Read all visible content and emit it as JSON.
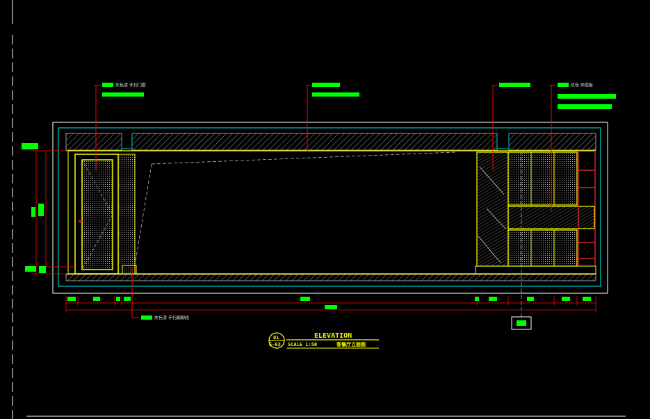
{
  "drawing": {
    "title": "ELEVATION",
    "scale": "SCALE 1:50",
    "subtitle": "客餐厅立面图",
    "bubble_top": "01",
    "bubble_bottom": "E-03"
  },
  "callouts": {
    "top_left_1": "灰色漆 手扫门套",
    "top_right_1": "灰色 饰面板",
    "bottom_left_1": "灰色漆 手扫踢脚线"
  },
  "colors": {
    "background": "#000000",
    "leader": "#ff0000",
    "tag": "#00ff00",
    "outline": "#ffff00",
    "wall": "#00c8c8",
    "hatch": "#a0a0a0",
    "frame": "#ffffff"
  }
}
